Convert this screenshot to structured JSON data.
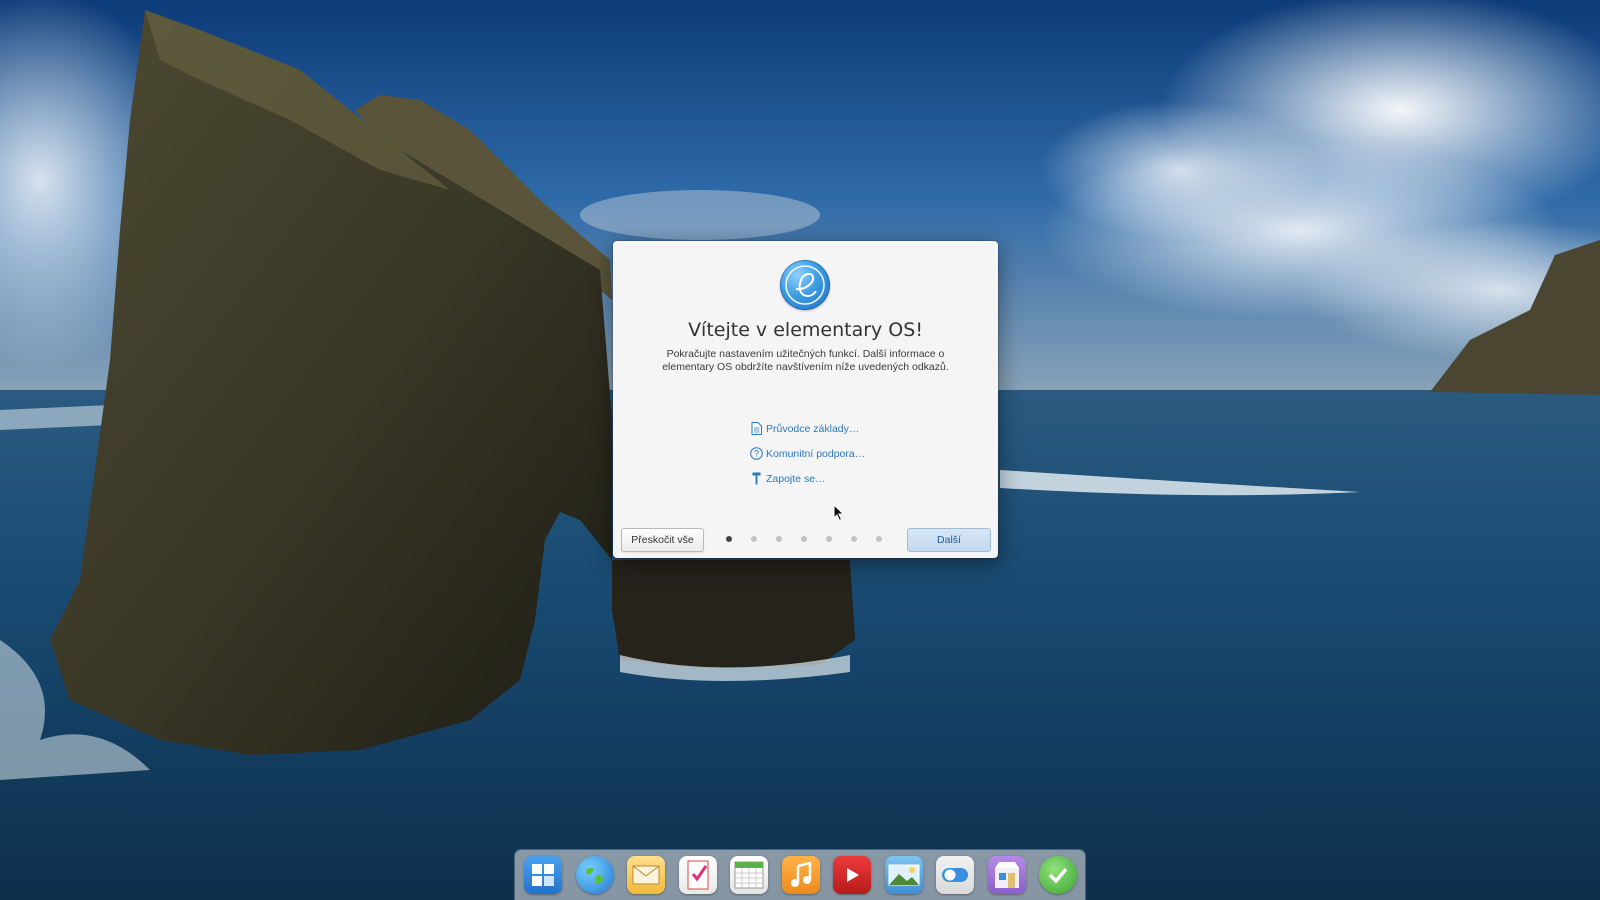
{
  "dialog": {
    "title": "Vítejte v elementary OS!",
    "subtitle": "Pokračujte nastavením užitečných funkcí. Další informace o elementary OS obdržíte navštívením níže uvedených odkazů.",
    "links": [
      {
        "label": "Průvodce základy…",
        "icon": "document-icon"
      },
      {
        "label": "Komunitní podpora…",
        "icon": "help-icon"
      },
      {
        "label": "Zapojte se…",
        "icon": "hammer-icon"
      }
    ],
    "skip_label": "Přeskočit vše",
    "next_label": "Další",
    "pages_total": 7,
    "current_page": 1
  },
  "dock": {
    "apps": [
      {
        "name": "multitasking-view",
        "icon": "multitasking-icon"
      },
      {
        "name": "web-browser",
        "icon": "globe-icon"
      },
      {
        "name": "mail",
        "icon": "mail-icon"
      },
      {
        "name": "tasks",
        "icon": "tasks-icon"
      },
      {
        "name": "calendar",
        "icon": "calendar-icon"
      },
      {
        "name": "music",
        "icon": "music-icon"
      },
      {
        "name": "videos",
        "icon": "video-icon"
      },
      {
        "name": "photos",
        "icon": "photos-icon"
      },
      {
        "name": "system-settings",
        "icon": "settings-toggle-icon"
      },
      {
        "name": "appcenter",
        "icon": "appcenter-icon"
      },
      {
        "name": "updates",
        "icon": "checkmark-icon"
      }
    ]
  },
  "colors": {
    "accent": "#2a78c2",
    "dialog_bg": "#f5f5f5"
  }
}
